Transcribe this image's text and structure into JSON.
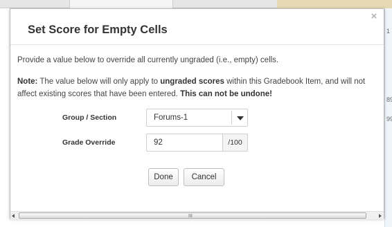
{
  "background": {
    "right_edge_texts": [
      "1",
      "89",
      "99"
    ]
  },
  "modal": {
    "title": "Set Score for Empty Cells",
    "close_glyph": "×",
    "description": "Provide a value below to override all currently ungraded (i.e., empty) cells.",
    "note": {
      "label": "Note:",
      "text_1": " The value below will only apply to ",
      "emphasis": "ungraded scores",
      "text_2": " within this Gradebook Item, and will not affect existing scores that have been entered. ",
      "warning": "This can not be undone!"
    },
    "form": {
      "group_label": "Group / Section",
      "group_value": "Forums-1",
      "grade_label": "Grade Override",
      "grade_value": "92",
      "grade_suffix": "/100"
    },
    "buttons": {
      "done": "Done",
      "cancel": "Cancel"
    },
    "scrollbar": {
      "grip": "III"
    }
  },
  "colors": {
    "title_text": "#333333",
    "close_icon": "#b3b3b3",
    "border": "#cfcfcf"
  }
}
